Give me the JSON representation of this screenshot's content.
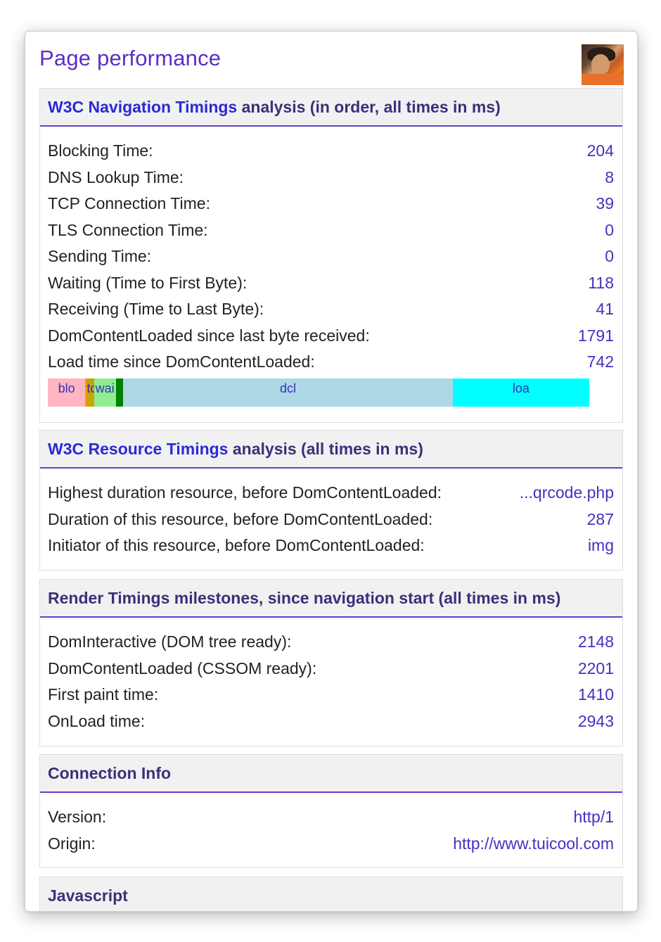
{
  "title": "Page performance",
  "avatar_label": "user-avatar",
  "colors": {
    "accent": "#5a2ec7",
    "value": "#4a2ec0",
    "link": "#2a2ad8",
    "blocking": "#ffb6c1",
    "dns": "#ff9a00",
    "tcp": "#c8a400",
    "waiting": "#90ee90",
    "receiving": "#008000",
    "dcl": "#add8e6",
    "load": "#00ffff"
  },
  "nav": {
    "heading_link": "W3C Navigation Timings",
    "heading_rest": " analysis (in order, all times in ms)",
    "rows": [
      {
        "label": "Blocking Time:",
        "value": "204"
      },
      {
        "label": "DNS Lookup Time:",
        "value": "8"
      },
      {
        "label": "TCP Connection Time:",
        "value": "39"
      },
      {
        "label": "TLS Connection Time:",
        "value": "0"
      },
      {
        "label": "Sending Time:",
        "value": "0"
      },
      {
        "label": "Waiting (Time to First Byte):",
        "value": "118"
      },
      {
        "label": "Receiving (Time to Last Byte):",
        "value": "41"
      },
      {
        "label": "DomContentLoaded since last byte received:",
        "value": "1791"
      },
      {
        "label": "Load time since DomContentLoaded:",
        "value": "742"
      }
    ],
    "bar": [
      {
        "key": "blocking",
        "label": "blo",
        "ms": 204
      },
      {
        "key": "dns",
        "label": "",
        "ms": 8
      },
      {
        "key": "tcp",
        "label": "tcp",
        "ms": 39
      },
      {
        "key": "waiting",
        "label": "wai",
        "ms": 118
      },
      {
        "key": "receiving",
        "label": "",
        "ms": 41
      },
      {
        "key": "dcl",
        "label": "dcl",
        "ms": 1791
      },
      {
        "key": "load",
        "label": "loa",
        "ms": 742
      }
    ]
  },
  "resource": {
    "heading_link": "W3C Resource Timings",
    "heading_rest": " analysis (all times in ms)",
    "rows": [
      {
        "label": "Highest duration resource, before DomContentLoaded:",
        "value": "...qrcode.php"
      },
      {
        "label": "Duration of this resource, before DomContentLoaded:",
        "value": "287"
      },
      {
        "label": "Initiator of this resource, before DomContentLoaded:",
        "value": "img"
      }
    ]
  },
  "render": {
    "heading": "Render Timings milestones, since navigation start (all times in ms)",
    "rows": [
      {
        "label": "DomInteractive (DOM tree ready):",
        "value": "2148"
      },
      {
        "label": "DomContentLoaded (CSSOM ready):",
        "value": "2201"
      },
      {
        "label": "First paint time:",
        "value": "1410"
      },
      {
        "label": "OnLoad time:",
        "value": "2943"
      }
    ]
  },
  "connection": {
    "heading": "Connection Info",
    "rows": [
      {
        "label": "Version:",
        "value": "http/1"
      },
      {
        "label": "Origin:",
        "value": "http://www.tuicool.com"
      }
    ]
  },
  "javascript": {
    "heading": "Javascript"
  }
}
